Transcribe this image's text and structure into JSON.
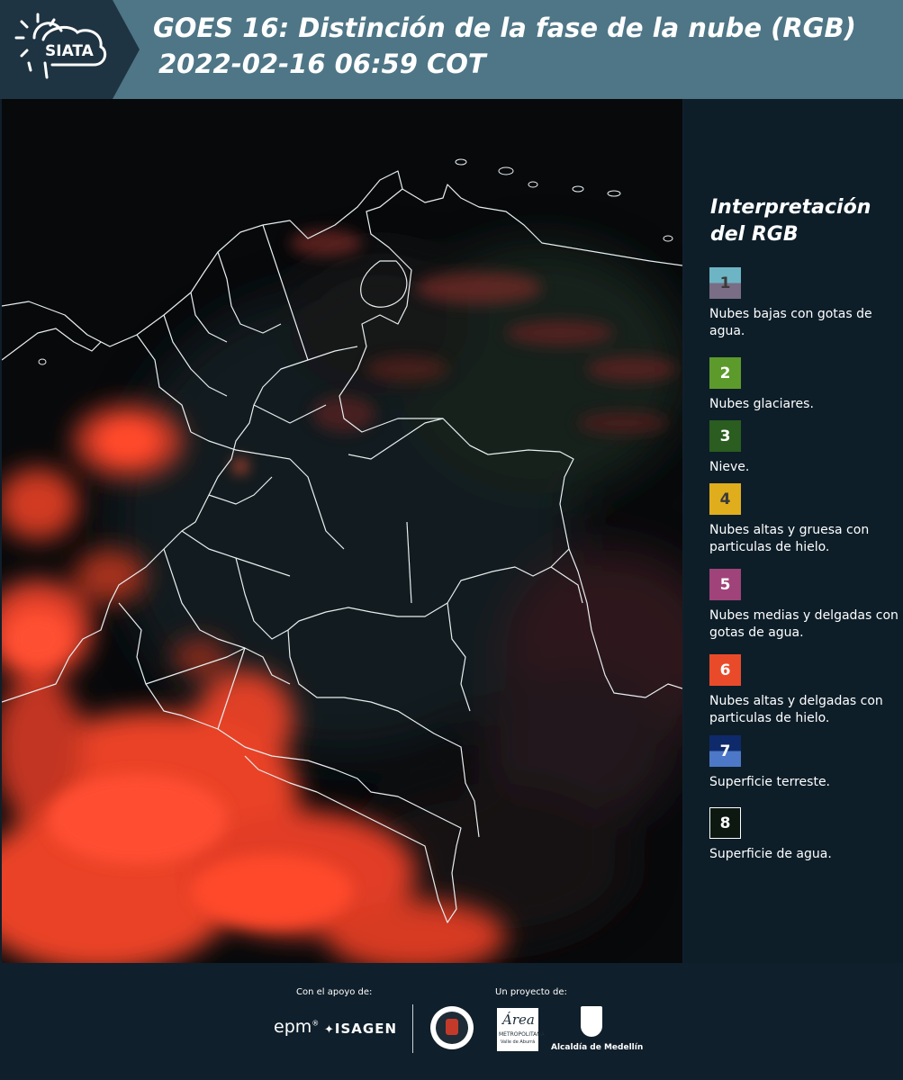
{
  "header": {
    "logo_text": "SIATA",
    "title_line1": "GOES 16: Distinción de la fase de la nube (RGB)",
    "title_line2": "2022-02-16 06:59 COT"
  },
  "legend": {
    "title": "Interpretación del RGB",
    "items": [
      {
        "num": "1",
        "label": "Nubes bajas con gotas de agua.",
        "color_top": "#6db5c4",
        "color_bottom": "#7a6d86"
      },
      {
        "num": "2",
        "label": "Nubes glaciares.",
        "color_top": "#5d9a2c",
        "color_bottom": "#5d9a2c"
      },
      {
        "num": "3",
        "label": "Nieve.",
        "color_top": "#2a5d1f",
        "color_bottom": "#2a5d1f"
      },
      {
        "num": "4",
        "label": "Nubes altas y gruesa con particulas de hielo.",
        "color_top": "#e0ad1d",
        "color_bottom": "#e0ad1d"
      },
      {
        "num": "5",
        "label": "Nubes medias y delgadas con gotas de agua.",
        "color_top": "#a0437a",
        "color_bottom": "#a0437a"
      },
      {
        "num": "6",
        "label": "Nubes altas y delgadas con particulas de hielo.",
        "color_top": "#e94b2a",
        "color_bottom": "#e94b2a"
      },
      {
        "num": "7",
        "label": "Superficie terreste.",
        "color_top": "#0f2a6a",
        "color_bottom": "#4d78c7"
      },
      {
        "num": "8",
        "label": "Superficie de agua.",
        "color_top": "#0c1810",
        "color_bottom": "#0c1810"
      }
    ]
  },
  "footer": {
    "support_label": "Con el apoyo de:",
    "project_label": "Un proyecto de:",
    "sponsor1": "epm",
    "sponsor2": "ISAGEN",
    "partner_area": "Área",
    "partner_area_sub": "METROPOLITANA",
    "partner_area_sub2": "Valle de Aburrá",
    "partner_alcaldia": "Alcaldía de Medellín"
  }
}
